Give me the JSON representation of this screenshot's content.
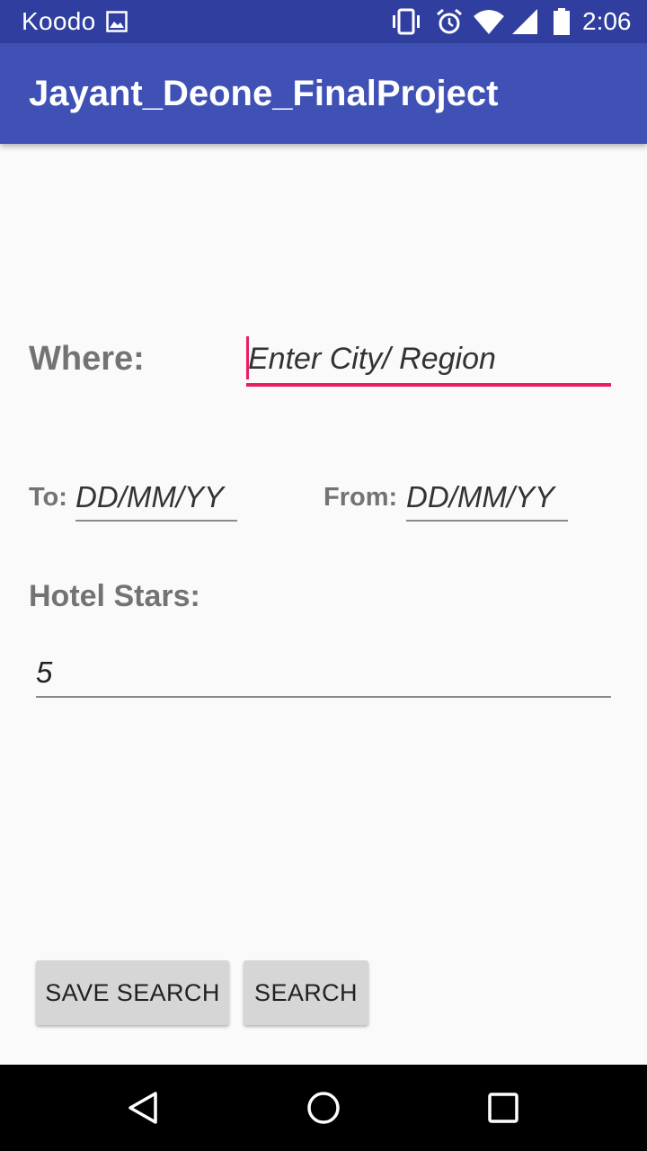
{
  "status_bar": {
    "carrier": "Koodo",
    "time": "2:06",
    "icons": [
      "gallery-icon",
      "vibrate-icon",
      "alarm-icon",
      "wifi-icon",
      "signal-icon",
      "battery-icon"
    ]
  },
  "app_bar": {
    "title": "Jayant_Deone_FinalProject"
  },
  "form": {
    "where_label": "Where:",
    "where_placeholder": "Enter City/ Region",
    "to_label": "To:",
    "to_placeholder": "DD/MM/YY",
    "from_label": "From:",
    "from_placeholder": "DD/MM/YY",
    "stars_label": "Hotel Stars:",
    "stars_value": "5"
  },
  "buttons": {
    "save_search": "SAVE SEARCH",
    "search": "SEARCH"
  },
  "nav_bar": {
    "icons": [
      "back-icon",
      "home-icon",
      "recents-icon"
    ]
  },
  "colors": {
    "status_bar": "#303f9f",
    "app_bar": "#3f51b5",
    "accent": "#e91e63",
    "background": "#fafafa"
  }
}
